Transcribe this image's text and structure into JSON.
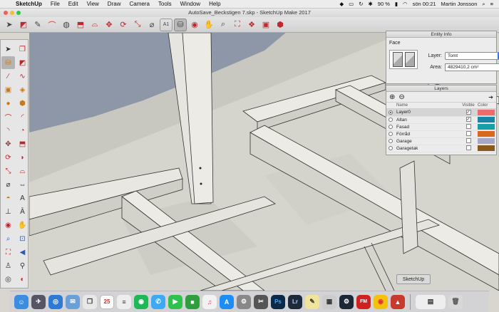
{
  "menubar": {
    "app_name": "SketchUp",
    "items": [
      "File",
      "Edit",
      "View",
      "Draw",
      "Camera",
      "Tools",
      "Window",
      "Help"
    ],
    "battery": "90 %",
    "clock": "sön 00:21",
    "user": "Martin Jonsson"
  },
  "window": {
    "title": "AutoSave_Beckstigen 7.skp - SketchUp Make 2017"
  },
  "toolbar": {
    "tools": [
      "select",
      "eraser",
      "line",
      "arc",
      "shapes",
      "push-pull",
      "offset",
      "move",
      "rotate",
      "scale",
      "tape-measure",
      "text",
      "paint-bucket",
      "orbit",
      "pan",
      "zoom",
      "zoom-extents",
      "3d-warehouse",
      "extension-warehouse",
      "extension-manager"
    ]
  },
  "entity_info": {
    "panel_title": "Entity Info",
    "entity_type": "Face",
    "layer_label": "Layer:",
    "layer_value": "Tomt",
    "area_label": "Area:",
    "area_value": "4829410,2 cm²"
  },
  "layers_panel": {
    "panel_title": "Layers",
    "col_name": "Name",
    "col_visible": "Visible",
    "col_color": "Color",
    "rows": [
      {
        "name": "Layer0",
        "active": true,
        "visible": true,
        "color": "#ef6b6b"
      },
      {
        "name": "Altan",
        "active": false,
        "visible": true,
        "color": "#1784a8"
      },
      {
        "name": "Fasad",
        "active": false,
        "visible": false,
        "color": "#15a0a7"
      },
      {
        "name": "Förråd",
        "active": false,
        "visible": false,
        "color": "#d8691c"
      },
      {
        "name": "Garage",
        "active": false,
        "visible": false,
        "color": "#a7a8c8"
      },
      {
        "name": "Garagetak",
        "active": false,
        "visible": false,
        "color": "#8a5a1c"
      }
    ]
  },
  "tooltip": "SketchUp",
  "dock": {
    "calendar_day": "25"
  }
}
